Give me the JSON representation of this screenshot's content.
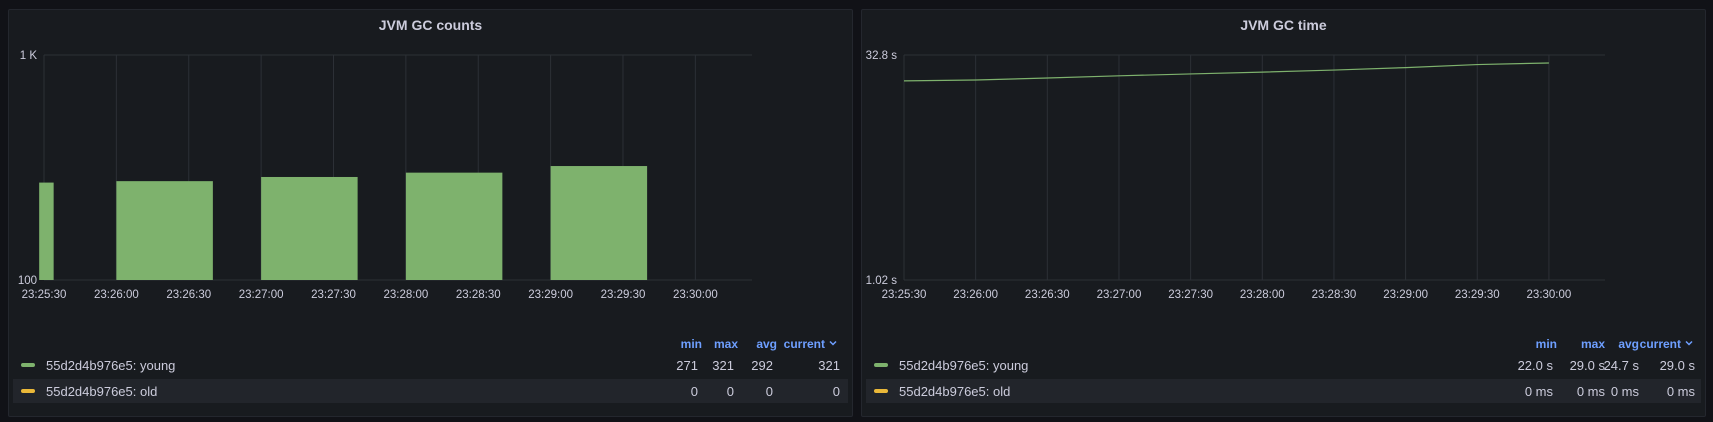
{
  "colors": {
    "young": "#7eb26d",
    "old": "#eab839",
    "grid": "#2c3036"
  },
  "panels": [
    {
      "title": "JVM GC counts",
      "legend": {
        "headers": {
          "min": "min",
          "max": "max",
          "avg": "avg",
          "current": "current"
        },
        "sort_icon": "chevron-down-icon",
        "rows": [
          {
            "name": "55d2d4b976e5: young",
            "min": "271",
            "max": "321",
            "avg": "292",
            "current": "321"
          },
          {
            "name": "55d2d4b976e5: old",
            "min": "0",
            "max": "0",
            "avg": "0",
            "current": "0"
          }
        ]
      }
    },
    {
      "title": "JVM GC time",
      "legend": {
        "headers": {
          "min": "min",
          "max": "max",
          "avg": "avg",
          "current": "current"
        },
        "sort_icon": "chevron-down-icon",
        "rows": [
          {
            "name": "55d2d4b976e5: young",
            "min": "22.0 s",
            "max": "29.0 s",
            "avg": "24.7 s",
            "current": "29.0 s"
          },
          {
            "name": "55d2d4b976e5: old",
            "min": "0 ms",
            "max": "0 ms",
            "avg": "0 ms",
            "current": "0 ms"
          }
        ]
      }
    }
  ],
  "chart_data": [
    {
      "type": "bar",
      "title": "JVM GC counts",
      "y_scale": "log",
      "ylim": [
        100,
        1000
      ],
      "y_tick_labels": [
        "1 K",
        "100"
      ],
      "x_tick_labels": [
        "23:25:30",
        "23:26:00",
        "23:26:30",
        "23:27:00",
        "23:27:30",
        "23:28:00",
        "23:28:30",
        "23:29:00",
        "23:29:30",
        "23:30:00"
      ],
      "grid": true,
      "legend_placement": "bottom",
      "series": [
        {
          "name": "55d2d4b976e5: young",
          "bars": [
            {
              "start": "23:25:28",
              "end": "23:25:34",
              "value": 271
            },
            {
              "start": "23:26:00",
              "end": "23:26:40",
              "value": 275
            },
            {
              "start": "23:27:00",
              "end": "23:27:40",
              "value": 287
            },
            {
              "start": "23:28:00",
              "end": "23:28:40",
              "value": 300
            },
            {
              "start": "23:29:00",
              "end": "23:29:40",
              "value": 321
            }
          ]
        }
      ]
    },
    {
      "type": "line",
      "title": "JVM GC time",
      "y_scale": "log",
      "ylim": [
        1.02,
        32.8
      ],
      "y_tick_labels": [
        "32.8 s",
        "1.02 s"
      ],
      "x_tick_labels": [
        "23:25:30",
        "23:26:00",
        "23:26:30",
        "23:27:00",
        "23:27:30",
        "23:28:00",
        "23:28:30",
        "23:29:00",
        "23:29:30",
        "23:30:00"
      ],
      "grid": true,
      "legend_placement": "bottom",
      "series": [
        {
          "name": "55d2d4b976e5: young",
          "x": [
            "23:25:30",
            "23:26:00",
            "23:26:30",
            "23:27:00",
            "23:27:30",
            "23:28:00",
            "23:28:30",
            "23:29:00",
            "23:29:30",
            "23:30:00"
          ],
          "y": [
            22.0,
            22.3,
            23.0,
            23.8,
            24.5,
            25.2,
            26.0,
            27.0,
            28.3,
            29.0
          ]
        }
      ]
    }
  ]
}
